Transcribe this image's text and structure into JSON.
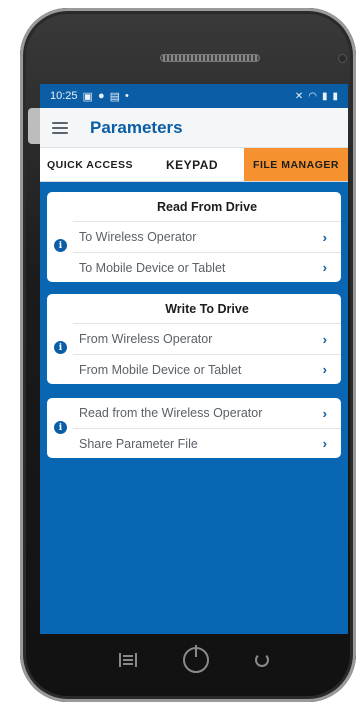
{
  "status": {
    "time": "10:25",
    "dot": "•"
  },
  "appbar": {
    "title": "Parameters"
  },
  "tabs": [
    {
      "label": "QUICK ACCESS"
    },
    {
      "label": "KEYPAD"
    },
    {
      "label": "FILE MANAGER",
      "active": true
    }
  ],
  "cards": {
    "read": {
      "header": "Read From Drive",
      "items": [
        {
          "label": "To Wireless Operator"
        },
        {
          "label": "To Mobile Device or Tablet"
        }
      ]
    },
    "write": {
      "header": "Write To Drive",
      "items": [
        {
          "label": "From Wireless Operator"
        },
        {
          "label": "From Mobile Device or Tablet"
        }
      ]
    },
    "other": {
      "items": [
        {
          "label": "Read from the Wireless Operator"
        },
        {
          "label": "Share Parameter File"
        }
      ]
    }
  },
  "icons": {
    "chevron": "›",
    "info": "i"
  },
  "colors": {
    "primary": "#0b5ea5",
    "accent": "#f5922f",
    "screen_bg": "#0866b3"
  }
}
